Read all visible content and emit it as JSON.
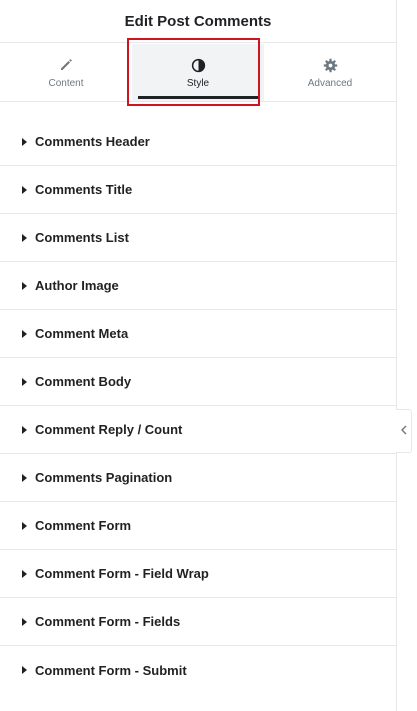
{
  "header": {
    "title": "Edit Post Comments"
  },
  "tabs": [
    {
      "label": "Content",
      "icon": "pencil-icon",
      "active": false
    },
    {
      "label": "Style",
      "icon": "contrast-icon",
      "active": true
    },
    {
      "label": "Advanced",
      "icon": "gear-icon",
      "active": false
    }
  ],
  "sections": [
    {
      "label": "Comments Header"
    },
    {
      "label": "Comments Title"
    },
    {
      "label": "Comments List"
    },
    {
      "label": "Author Image"
    },
    {
      "label": "Comment Meta"
    },
    {
      "label": "Comment Body"
    },
    {
      "label": "Comment Reply / Count"
    },
    {
      "label": "Comments Pagination"
    },
    {
      "label": "Comment Form"
    },
    {
      "label": "Comment Form - Field Wrap"
    },
    {
      "label": "Comment Form - Fields"
    },
    {
      "label": "Comment Form - Submit"
    }
  ],
  "colors": {
    "text": "#1f2124",
    "muted": "#6d7882",
    "active_tab_bg": "#f1f3f5",
    "highlight": "#d0141f",
    "divider": "#e6e8ea"
  }
}
